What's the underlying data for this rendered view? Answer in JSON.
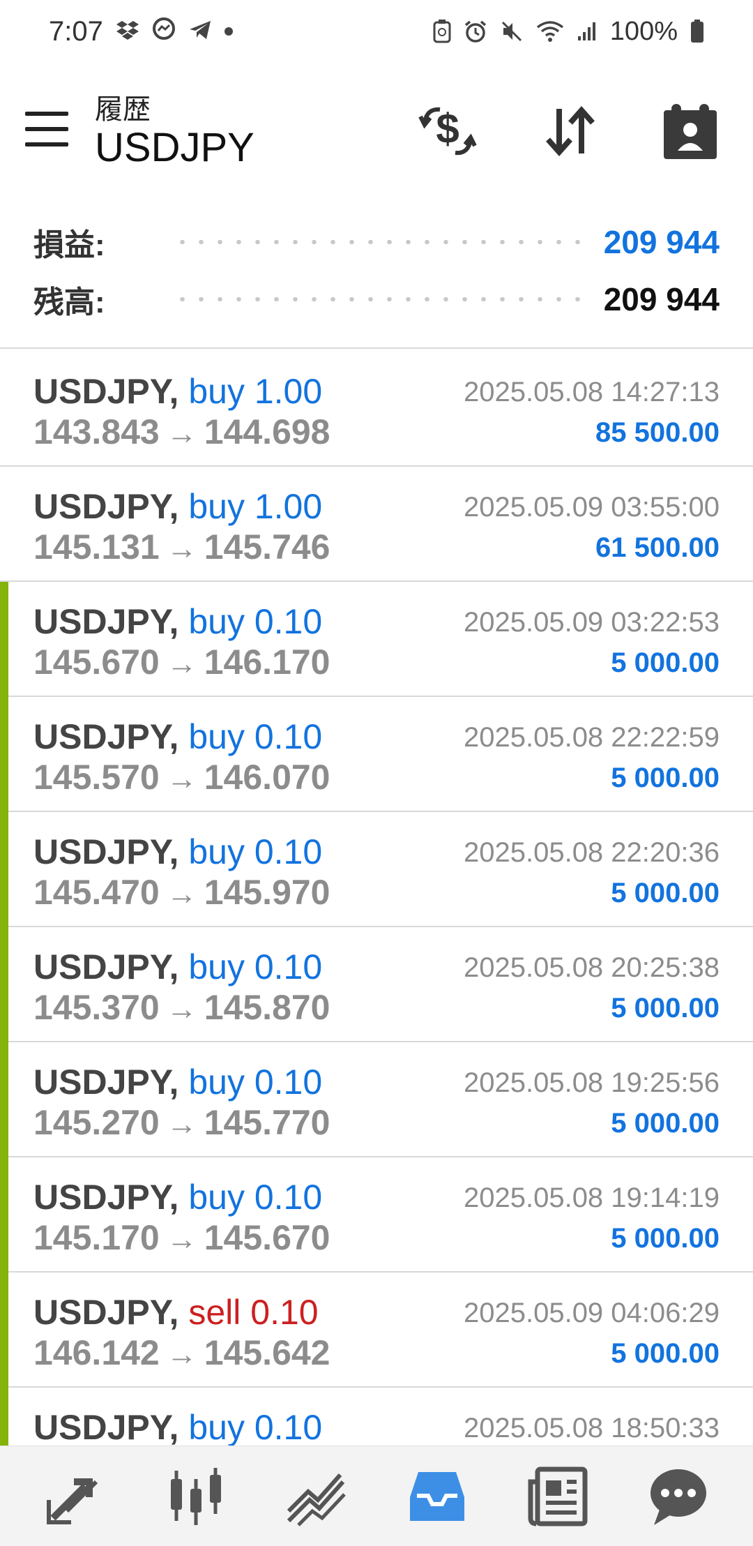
{
  "status_bar": {
    "time": "7:07",
    "battery": "100%",
    "icons_left": [
      "dropbox-icon",
      "messenger-icon",
      "telegram-icon",
      "dot-icon"
    ],
    "icons_right": [
      "nfc-icon",
      "alarm-icon",
      "mute-icon",
      "wifi-icon",
      "signal-icon",
      "battery-icon"
    ]
  },
  "header": {
    "subtitle": "履歴",
    "title": "USDJPY",
    "actions": [
      "currency-exchange-icon",
      "sort-icon",
      "calendar-icon"
    ]
  },
  "summary": {
    "profit_label": "損益:",
    "profit_value": "209 944",
    "balance_label": "残高:",
    "balance_value": "209 944"
  },
  "deals": [
    {
      "symbol": "USDJPY,",
      "type": "buy",
      "type_label": "buy 1.00",
      "open": "143.843",
      "close": "144.698",
      "time": "2025.05.08 14:27:13",
      "profit": "85 500.00",
      "marked": false
    },
    {
      "symbol": "USDJPY,",
      "type": "buy",
      "type_label": "buy 1.00",
      "open": "145.131",
      "close": "145.746",
      "time": "2025.05.09 03:55:00",
      "profit": "61 500.00",
      "marked": false
    },
    {
      "symbol": "USDJPY,",
      "type": "buy",
      "type_label": "buy 0.10",
      "open": "145.670",
      "close": "146.170",
      "time": "2025.05.09 03:22:53",
      "profit": "5 000.00",
      "marked": true
    },
    {
      "symbol": "USDJPY,",
      "type": "buy",
      "type_label": "buy 0.10",
      "open": "145.570",
      "close": "146.070",
      "time": "2025.05.08 22:22:59",
      "profit": "5 000.00",
      "marked": true
    },
    {
      "symbol": "USDJPY,",
      "type": "buy",
      "type_label": "buy 0.10",
      "open": "145.470",
      "close": "145.970",
      "time": "2025.05.08 22:20:36",
      "profit": "5 000.00",
      "marked": true
    },
    {
      "symbol": "USDJPY,",
      "type": "buy",
      "type_label": "buy 0.10",
      "open": "145.370",
      "close": "145.870",
      "time": "2025.05.08 20:25:38",
      "profit": "5 000.00",
      "marked": true
    },
    {
      "symbol": "USDJPY,",
      "type": "buy",
      "type_label": "buy 0.10",
      "open": "145.270",
      "close": "145.770",
      "time": "2025.05.08 19:25:56",
      "profit": "5 000.00",
      "marked": true
    },
    {
      "symbol": "USDJPY,",
      "type": "buy",
      "type_label": "buy 0.10",
      "open": "145.170",
      "close": "145.670",
      "time": "2025.05.08 19:14:19",
      "profit": "5 000.00",
      "marked": true
    },
    {
      "symbol": "USDJPY,",
      "type": "sell",
      "type_label": "sell 0.10",
      "open": "146.142",
      "close": "145.642",
      "time": "2025.05.09 04:06:29",
      "profit": "5 000.00",
      "marked": true
    },
    {
      "symbol": "USDJPY,",
      "type": "buy",
      "type_label": "buy 0.10",
      "open": "",
      "close": "",
      "time": "2025.05.08 18:50:33",
      "profit": "",
      "marked": true
    }
  ],
  "bottom_nav": {
    "items": [
      "trade-arrows-icon",
      "candlestick-chart-icon",
      "trend-chart-icon",
      "history-inbox-icon",
      "news-icon",
      "chat-icon"
    ],
    "active": "history-inbox-icon",
    "active_color": "#3d8fe6",
    "inactive_color": "#555555"
  },
  "colors": {
    "buy": "#1273de",
    "sell": "#cc2020",
    "profit": "#1273de",
    "marker": "#84b30a"
  }
}
